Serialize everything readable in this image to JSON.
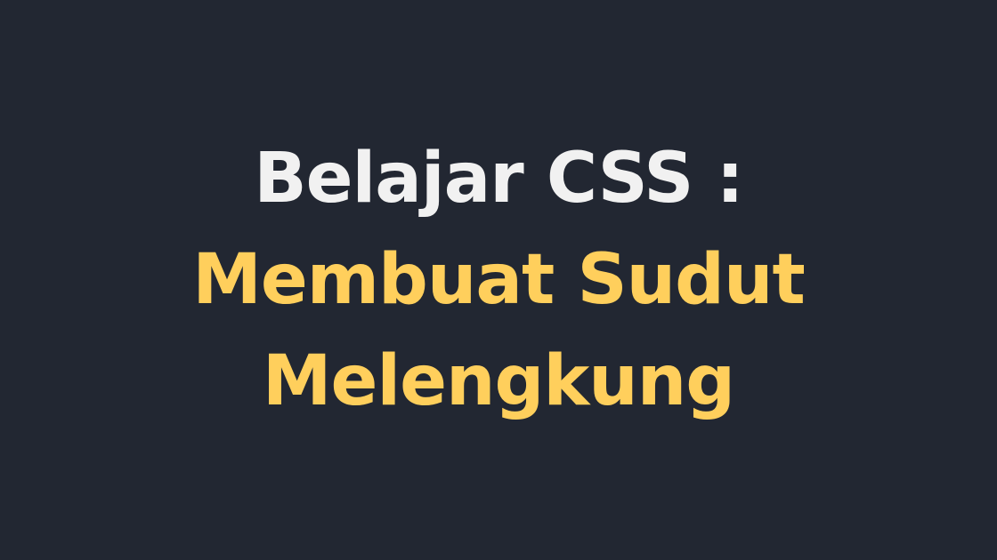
{
  "title": {
    "line1": "Belajar CSS :",
    "line2": "Membuat Sudut",
    "line3": "Melengkung"
  },
  "colors": {
    "background": "#222732",
    "primary_text": "#f1f1f1",
    "accent_text": "#ffcf5c"
  }
}
